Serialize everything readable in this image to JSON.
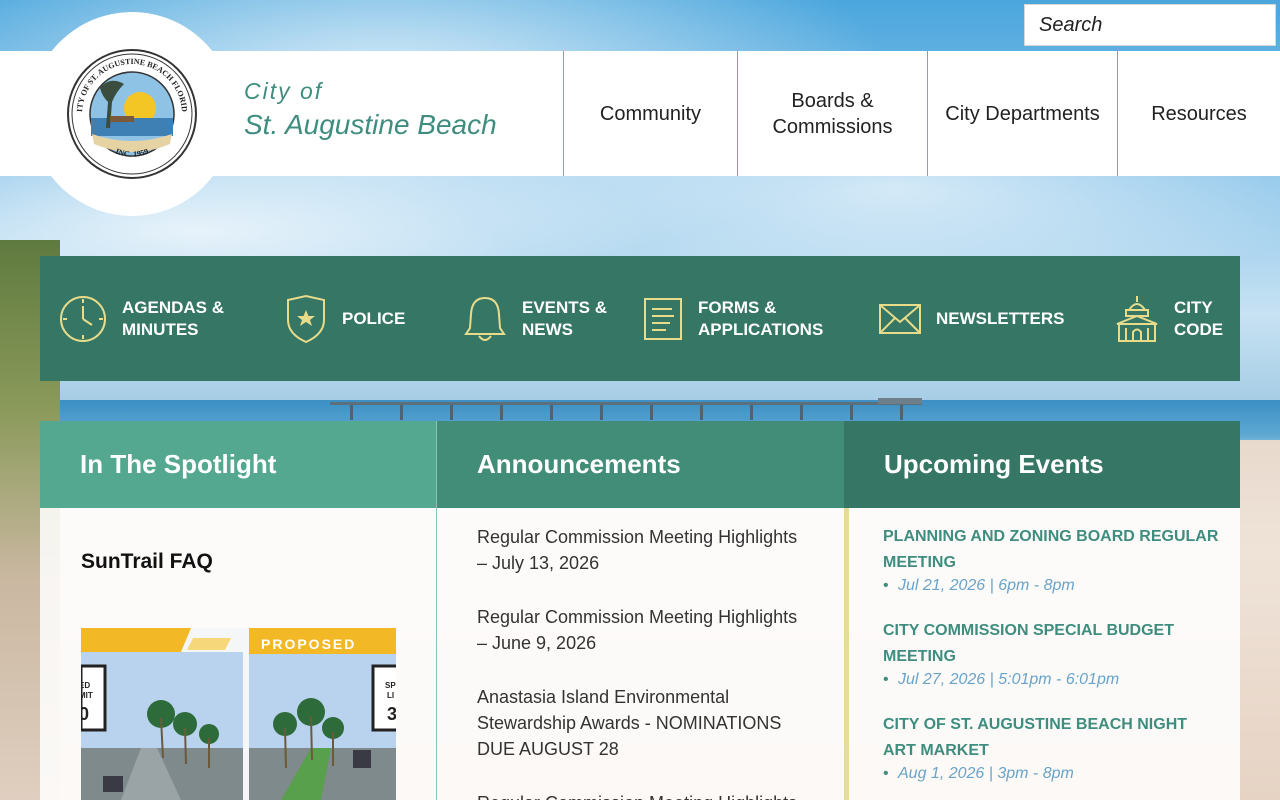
{
  "search": {
    "placeholder": "Search"
  },
  "brand": {
    "line1": "City of",
    "line2": "St. Augustine Beach"
  },
  "seal": {
    "top_text": "CITY OF ST. AUGUSTINE BEACH FLORIDA",
    "bottom_text": "INC. 1959"
  },
  "nav": [
    {
      "label": "Community"
    },
    {
      "label": "Boards & Commissions"
    },
    {
      "label": "City Departments"
    },
    {
      "label": "Resources"
    }
  ],
  "quick_links": [
    {
      "label": "AGENDAS & MINUTES",
      "icon": "clock-icon"
    },
    {
      "label": "POLICE",
      "icon": "badge-icon"
    },
    {
      "label": "EVENTS & NEWS",
      "icon": "bell-icon"
    },
    {
      "label": "FORMS & APPLICATIONS",
      "icon": "document-icon"
    },
    {
      "label": "NEWSLETTERS",
      "icon": "envelope-icon"
    },
    {
      "label": "CITY CODE",
      "icon": "city-hall-icon"
    }
  ],
  "spotlight": {
    "heading": "In The Spotlight",
    "title": "SunTrail FAQ",
    "image_left_sign": "ED\nMIT\n0",
    "image_right_banner": "PROPOSED",
    "image_right_sign": "SP\nLI\n3"
  },
  "announcements": {
    "heading": "Announcements",
    "items": [
      "Regular Commission Meeting Highlights – July 13, 2026",
      "Regular Commission Meeting Highlights – June 9, 2026",
      "Anastasia Island Environmental Stewardship Awards - NOMINATIONS DUE AUGUST 28",
      "Regular Commission Meeting Highlights"
    ]
  },
  "events": {
    "heading": "Upcoming Events",
    "items": [
      {
        "title": "PLANNING AND ZONING BOARD REGULAR MEETING",
        "date": "Jul 21, 2026 | 6pm - 8pm"
      },
      {
        "title": "CITY COMMISSION SPECIAL BUDGET MEETING",
        "date": "Jul 27, 2026 | 5:01pm - 6:01pm"
      },
      {
        "title": "CITY OF ST. AUGUSTINE BEACH NIGHT ART MARKET",
        "date": "Aug 1, 2026 | 3pm - 8pm"
      }
    ]
  },
  "colors": {
    "brand_teal": "#3f8d7f",
    "quick_bar": "#357665",
    "spotlight_head": "#54a890",
    "announce_head": "#418d78",
    "search_button": "#e2c52a",
    "icon_yellow": "#e8dc8a"
  }
}
